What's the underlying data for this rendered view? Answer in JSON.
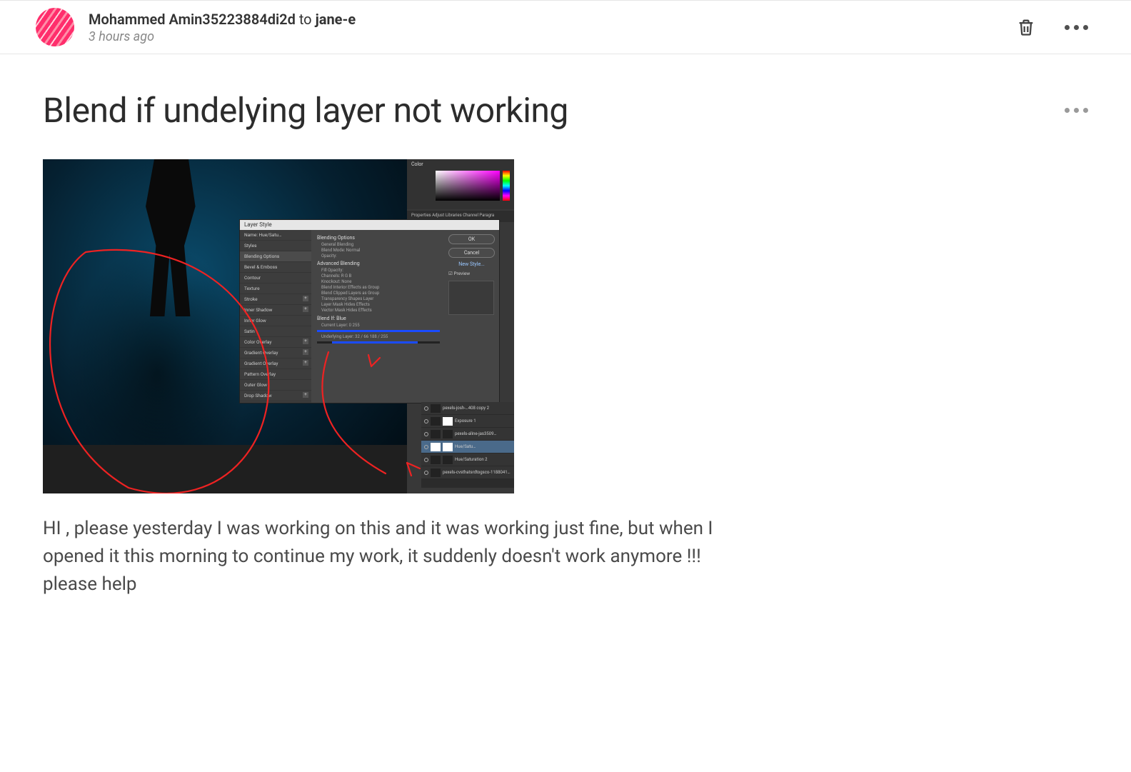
{
  "header": {
    "author": "Mohammed Amin35223884di2d",
    "to_word": "to",
    "recipient": "jane-e",
    "time_ago": "3 hours ago"
  },
  "post": {
    "title": "Blend if undelying layer not working",
    "body_text": "HI , please yesterday I was working on this and it was working just fine, but when I opened it this morning to continue my work, it suddenly doesn't work anymore !!! please help"
  },
  "screenshot": {
    "color_panel_tab": "Color",
    "properties_tabs": "Properties   Adjust   Libraries   Channel   Paragra",
    "layer_style": {
      "title": "Layer Style",
      "left_header": "Name:  Hue/Satu…",
      "styles_label": "Styles",
      "items": [
        "Blending Options",
        "Bevel & Emboss",
        "Contour",
        "Texture",
        "Stroke",
        "Inner Shadow",
        "Inner Glow",
        "Satin",
        "Color Overlay",
        "Gradient Overlay",
        "Gradient Overlay",
        "Pattern Overlay",
        "Outer Glow",
        "Drop Shadow"
      ],
      "mid": {
        "section1": "Blending Options",
        "sub1": "General Blending",
        "blend_mode_label": "Blend Mode:",
        "blend_mode_value": "Normal",
        "opacity_label": "Opacity:",
        "section2": "Advanced Blending",
        "fill_label": "Fill Opacity:",
        "channels_label": "Channels: R  G  B",
        "knockout_label": "Knockout:",
        "knockout_value": "None",
        "checks": [
          "Blend Interior Effects as Group",
          "Blend Clipped Layers as Group",
          "Transparency Shapes Layer",
          "Layer Mask Hides Effects",
          "Vector Mask Hides Effects"
        ],
        "blend_if_label": "Blend If:",
        "blend_if_value": "Blue",
        "this_layer_label": "Current Layer:",
        "this_layer_range": "0        255",
        "under_layer_label": "Underlying Layer:",
        "under_layer_range": "32 / 66        188 / 255"
      },
      "right": {
        "ok": "OK",
        "cancel": "Cancel",
        "new_style": "New Style...",
        "preview": "Preview"
      }
    },
    "layers": {
      "rows": [
        "pexels-josh-…408 copy 2",
        "Exposure 1",
        "pexels-aline-jas3509…",
        "Hue/Satu…",
        "Hue/Saturation 2",
        "pexels-cvsthatsrdtogsco-1188041…"
      ]
    }
  }
}
